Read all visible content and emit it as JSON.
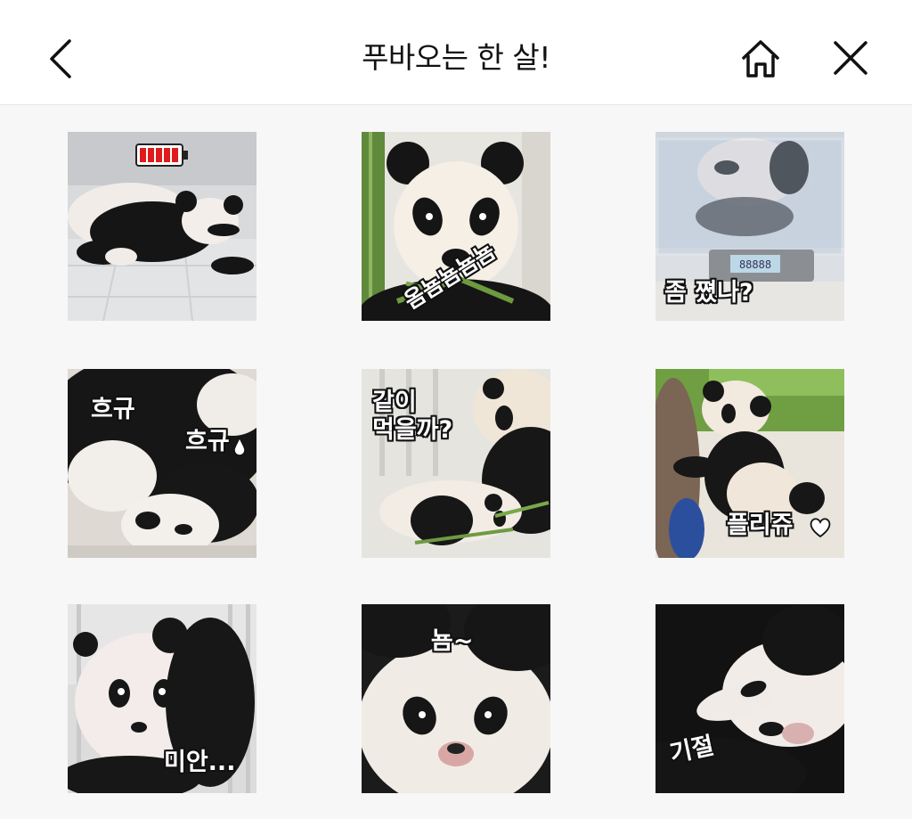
{
  "header": {
    "title": "푸바오는 한 살!",
    "back_icon": "chevron-left-icon",
    "home_icon": "home-icon",
    "close_icon": "close-icon"
  },
  "stickers": [
    {
      "caption": ""
    },
    {
      "caption": "옴뇸뇸뇸뇸"
    },
    {
      "caption": "좀 쪘나?"
    },
    {
      "caption": "흐규",
      "caption2": "흐규"
    },
    {
      "caption": "같이\n먹을까?"
    },
    {
      "caption": "플리쥬"
    },
    {
      "caption": "미안..."
    },
    {
      "caption": "뇸~"
    },
    {
      "caption": "기절"
    }
  ],
  "scale_display": "88888"
}
